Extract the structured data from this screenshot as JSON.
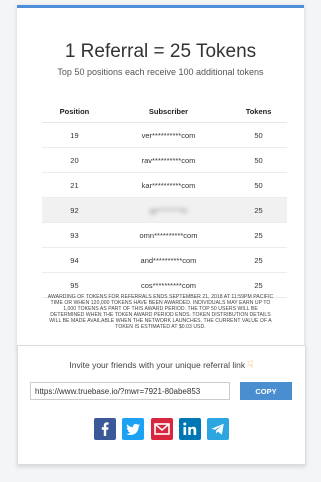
{
  "header": {
    "title": "1 Referral = 25 Tokens",
    "subtitle": "Top 50 positions each receive 100 additional tokens"
  },
  "leaderboard": {
    "columns": [
      "Position",
      "Subscriber",
      "Tokens"
    ],
    "rows": [
      {
        "position": "19",
        "subscriber": "ver**********com",
        "tokens": "50"
      },
      {
        "position": "20",
        "subscriber": "rav**********com",
        "tokens": "50"
      },
      {
        "position": "21",
        "subscriber": "kar**********com",
        "tokens": "50"
      },
      {
        "position": "92",
        "subscriber": "gx********m",
        "tokens": "25",
        "highlight": true
      },
      {
        "position": "93",
        "subscriber": "omn**********com",
        "tokens": "25"
      },
      {
        "position": "94",
        "subscriber": "and**********com",
        "tokens": "25"
      },
      {
        "position": "95",
        "subscriber": "cos**********com",
        "tokens": "25"
      }
    ]
  },
  "disclaimer": "Awarding of tokens for referrals ends September 21, 2018 at 11:59PM Pacific time or when 120,000 tokens have been awarded. Individuals may earn up to 1,000 tokens as part of this award period. The top 50 users will be determined when the token award period ends. Token distribution details will be made available when the network launches. The current value of a token is estimated at $0.03 USD.",
  "invite": {
    "text": "Invite your friends with your unique referral link",
    "hand_icon": "pointing-down-hand-icon",
    "link": "https://www.truebase.io/?mwr=7921-80abe853",
    "copy_label": "COPY"
  },
  "socials": [
    {
      "name": "facebook",
      "color": "#3b5998",
      "letter": "f"
    },
    {
      "name": "twitter",
      "color": "#1da1f2",
      "letter": "t"
    },
    {
      "name": "email",
      "color": "#d7263d",
      "letter": "m"
    },
    {
      "name": "linkedin",
      "color": "#0077b5",
      "letter": "in"
    },
    {
      "name": "telegram",
      "color": "#2ca5e0",
      "letter": "tg"
    }
  ]
}
